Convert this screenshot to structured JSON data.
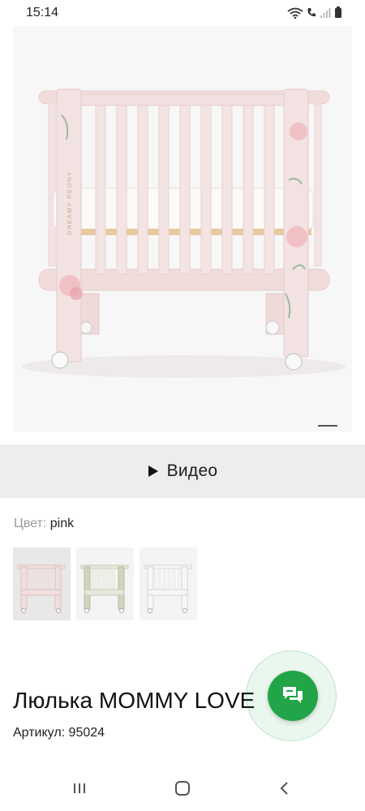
{
  "status_bar": {
    "time": "15:14"
  },
  "product_image": {
    "brand_print": "DREAMY PEONY"
  },
  "video": {
    "label": "Видео"
  },
  "color": {
    "label": "Цвет:",
    "value": "pink",
    "options": [
      "pink",
      "green",
      "white"
    ]
  },
  "product": {
    "title": "Люлька MOMMY LOVE",
    "sku_label": "Артикул:",
    "sku_value": "95024"
  },
  "colors": {
    "accent_green": "#21a548",
    "video_bg": "#ededed",
    "crib_pink": "#f0dede",
    "crib_green": "#dfe3d3",
    "crib_white": "#f3f3f3"
  },
  "nav": {
    "icons": [
      "recent-apps-icon",
      "home-icon",
      "back-icon"
    ]
  }
}
